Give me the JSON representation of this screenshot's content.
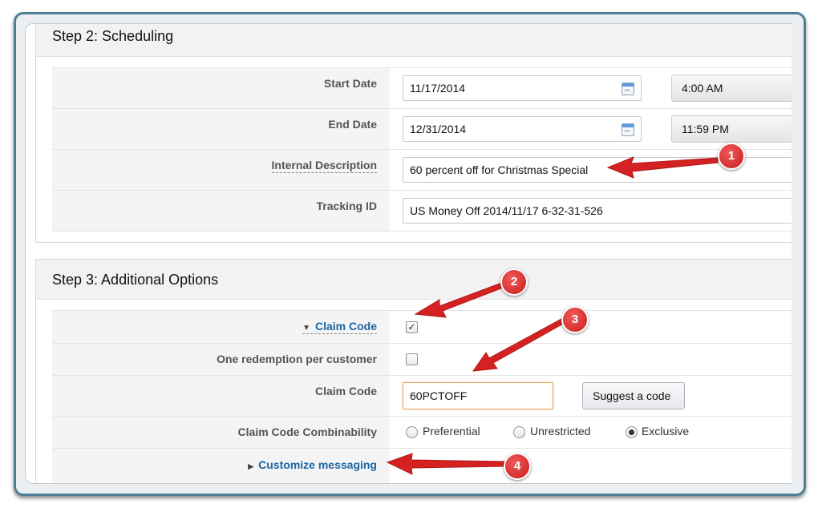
{
  "step2": {
    "title": "Step 2: Scheduling",
    "start_date": {
      "label": "Start Date",
      "date": "11/17/2014",
      "time": "4:00 AM"
    },
    "end_date": {
      "label": "End Date",
      "date": "12/31/2014",
      "time": "11:59 PM"
    },
    "internal_description": {
      "label": "Internal Description",
      "value": "60 percent off for Christmas Special"
    },
    "tracking_id": {
      "label": "Tracking ID",
      "value": "US Money Off 2014/11/17 6-32-31-526"
    }
  },
  "step3": {
    "title": "Step 3: Additional Options",
    "claim_code_toggle": {
      "label": "Claim Code",
      "checked": true
    },
    "one_redemption": {
      "label": "One redemption per customer",
      "checked": false
    },
    "claim_code": {
      "label": "Claim Code",
      "value": "60PCTOFF",
      "suggest_label": "Suggest a code"
    },
    "combinability": {
      "label": "Claim Code Combinability",
      "options": [
        "Preferential",
        "Unrestricted",
        "Exclusive"
      ],
      "selected": "Exclusive"
    },
    "customize_messaging": {
      "label": "Customize messaging"
    }
  },
  "annotations": {
    "badges": [
      "1",
      "2",
      "3",
      "4"
    ],
    "color": "#d42222"
  },
  "icons": {
    "calendar": "calendar-icon",
    "collapse": "triangle-down-icon",
    "expand": "triangle-right-icon"
  }
}
